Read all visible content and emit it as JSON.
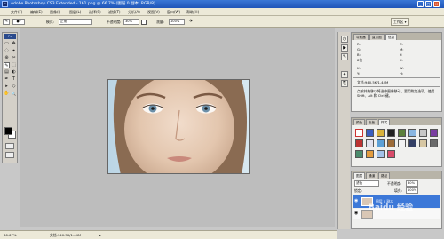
{
  "window": {
    "title": "Adobe Photoshop CS3 Extended - 161.png @ 66.7% (图层 0 副本, RGB/8)",
    "ps_badge": "Ps",
    "controls": [
      "_",
      "□",
      "✕"
    ]
  },
  "menu": {
    "items": [
      "文件(F)",
      "编辑(E)",
      "图像(I)",
      "图层(L)",
      "选择(S)",
      "滤镜(T)",
      "分析(A)",
      "视图(V)",
      "窗口(W)",
      "帮助(H)"
    ]
  },
  "options": {
    "mode_label": "模式:",
    "mode_value": "正常",
    "opacity_label": "不透明度:",
    "opacity_value": "30%",
    "flow_label": "流量:",
    "flow_value": "100%",
    "workspace_label": "工作区 ▾"
  },
  "toolbox": {
    "badge": "Ps",
    "tools": [
      "▭",
      "✥",
      "◌",
      "⌖",
      "⊕",
      "✂",
      "✎",
      "⬚",
      "▤",
      "◐",
      "✒",
      "T",
      "▸",
      "◇",
      "✋",
      "🔍"
    ]
  },
  "status": {
    "zoom": "66.67%",
    "doc_info": "文档:940.5K/1.44M"
  },
  "panels": {
    "info": {
      "tabs": [
        "导航器",
        "直方图",
        "信息"
      ],
      "rows": [
        [
          "R:",
          "C:"
        ],
        [
          "G:",
          "M:"
        ],
        [
          "B:",
          "Y:"
        ],
        [
          "8位",
          "K:"
        ],
        [
          "X:",
          "W:"
        ],
        [
          "Y:",
          "H:"
        ]
      ],
      "doc": "文档:940.5K/1.44M",
      "hint": "点按并拖移以将选中图像移动，要用附加选项，使用 Shift、Alt 和 Ctrl 键。"
    },
    "styles": {
      "tabs": [
        "颜色",
        "色板",
        "样式"
      ]
    },
    "layers": {
      "tabs": [
        "图层",
        "通道",
        "路径"
      ],
      "blend_mode": "滤色",
      "opacity_label": "不透明度:",
      "opacity_value": "30%",
      "fill_label": "填充:",
      "fill_value": "100%",
      "lock_label": "锁定:",
      "layer_name": "图层 0 副本"
    }
  },
  "watermark": "Baidu 经验",
  "colors": {
    "title_bar": "#2a66c9",
    "selected_layer": "#3c78d8",
    "foreground": "#000000",
    "background": "#ffffff"
  }
}
